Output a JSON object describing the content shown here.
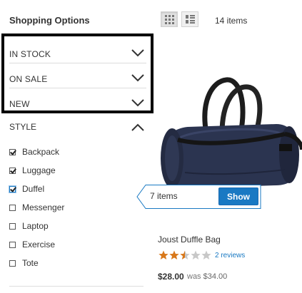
{
  "sidebar": {
    "title": "Shopping Options",
    "filters": [
      {
        "label": "IN STOCK"
      },
      {
        "label": "ON SALE"
      },
      {
        "label": "NEW"
      }
    ],
    "style_group": {
      "label": "STYLE",
      "options": [
        {
          "label": "Backpack",
          "checked": true
        },
        {
          "label": "Luggage",
          "checked": true
        },
        {
          "label": "Duffel",
          "checked": true
        },
        {
          "label": "Messenger",
          "checked": false
        },
        {
          "label": "Laptop",
          "checked": false
        },
        {
          "label": "Exercise",
          "checked": false
        },
        {
          "label": "Tote",
          "checked": false
        }
      ]
    }
  },
  "toolbar": {
    "view_modes": [
      "grid-icon",
      "list-icon"
    ],
    "active_mode": "grid",
    "item_count": "14 items"
  },
  "tooltip": {
    "text": "7 items",
    "button": "Show"
  },
  "product": {
    "name": "Joust Duffle Bag",
    "rating": 2.5,
    "rating_max": 5,
    "reviews": "2 reviews",
    "price": "$28.00",
    "was_label": "was",
    "was_price": "$34.00"
  },
  "colors": {
    "accent": "#1979c3",
    "star_filled": "#d8781b",
    "star_empty": "#c8c8c8",
    "highlight": "#000000"
  }
}
